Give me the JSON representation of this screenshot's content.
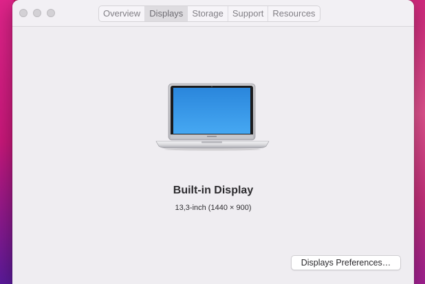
{
  "window": {
    "tabs": [
      {
        "label": "Overview",
        "active": false
      },
      {
        "label": "Displays",
        "active": true
      },
      {
        "label": "Storage",
        "active": false
      },
      {
        "label": "Support",
        "active": false
      },
      {
        "label": "Resources",
        "active": false
      }
    ]
  },
  "display": {
    "icon": "macbook-air-icon",
    "title": "Built-in Display",
    "subtitle": "13,3-inch (1440 × 900)"
  },
  "footer": {
    "preferences_button": "Displays Preferences…"
  },
  "colors": {
    "window_background": "#efedf1",
    "screen_blue": "#2f8fe0"
  }
}
